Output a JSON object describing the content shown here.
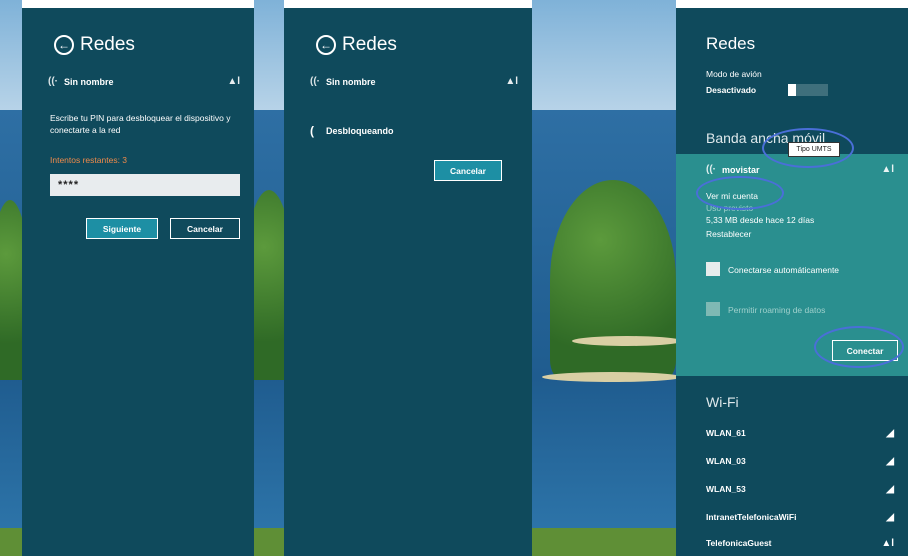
{
  "screen1": {
    "title": "Redes",
    "network_name": "Sin nombre",
    "prompt": "Escribe tu PIN para desbloquear el dispositivo y conectarte a la red",
    "attempts": "Intentos restantes: 3",
    "pin_value": "****",
    "next_button": "Siguiente",
    "cancel_button": "Cancelar"
  },
  "screen2": {
    "title": "Redes",
    "network_name": "Sin nombre",
    "status": "Desbloqueando",
    "cancel_button": "Cancelar"
  },
  "screen3": {
    "title": "Redes",
    "airplane_label": "Modo de avión",
    "airplane_state": "Desactivado",
    "broadband_title": "Banda ancha móvil",
    "tooltip": "Tipo UMTS",
    "provider": "movistar",
    "my_account": "Ver mi cuenta",
    "estimated_usage_label": "Uso previsto",
    "usage": "5,33 MB desde hace 12 días",
    "reset": "Restablecer",
    "auto_connect": "Conectarse automáticamente",
    "roaming": "Permitir roaming de datos",
    "connect_button": "Conectar",
    "wifi_title": "Wi-Fi",
    "wifi_networks": [
      "WLAN_61",
      "WLAN_03",
      "WLAN_53",
      "IntranetTelefonicaWiFi",
      "TelefonicaGuest"
    ]
  },
  "icons": {
    "back": "back-arrow-icon",
    "signal": "signal-bars-icon",
    "wifi": "network-icon",
    "spinner": "loading-spinner-icon"
  },
  "colors": {
    "panel": "#0f4a5c",
    "selected": "#2a8f8f",
    "warning": "#f08a4a",
    "highlight": "#4a6fd8"
  }
}
